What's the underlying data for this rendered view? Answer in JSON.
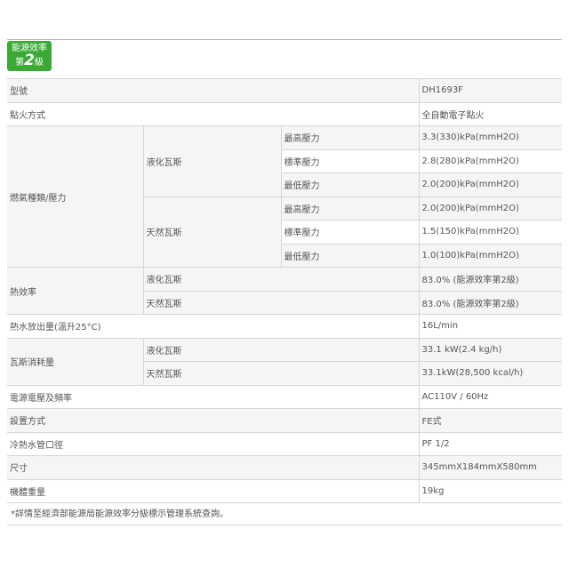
{
  "badge": {
    "line1": "能源效率",
    "rank_prefix": "第",
    "rank_num": "2",
    "rank_suffix": "級",
    "color": "#3aaa35"
  },
  "rows": {
    "model": {
      "label": "型號",
      "value": "DH1693F"
    },
    "ignition": {
      "label": "點火方式",
      "value": "全自動電子點火"
    },
    "gas_pressure": {
      "label": "燃氣種類/壓力",
      "lpg": {
        "label": "液化瓦斯",
        "max": {
          "label": "最高壓力",
          "value": "3.3(330)kPa(mmH2O)"
        },
        "std": {
          "label": "標準壓力",
          "value": "2.8(280)kPa(mmH2O)"
        },
        "min": {
          "label": "最低壓力",
          "value": "2.0(200)kPa(mmH2O)"
        }
      },
      "ng": {
        "label": "天然瓦斯",
        "max": {
          "label": "最高壓力",
          "value": "2.0(200)kPa(mmH2O)"
        },
        "std": {
          "label": "標準壓力",
          "value": "1.5(150)kPa(mmH2O)"
        },
        "min": {
          "label": "最低壓力",
          "value": "1.0(100)kPa(mmH2O)"
        }
      }
    },
    "efficiency": {
      "label": "熱效率",
      "lpg": {
        "label": "液化瓦斯",
        "value": "83.0% (能源效率第2級)"
      },
      "ng": {
        "label": "天然瓦斯",
        "value": "83.0% (能源效率第2級)"
      }
    },
    "hot_water": {
      "label": "熱水放出量(溫升25°C)",
      "value": "16L/min"
    },
    "consumption": {
      "label": "瓦斯消耗量",
      "lpg": {
        "label": "液化瓦斯",
        "value": "33.1 kW(2.4 kg/h)"
      },
      "ng": {
        "label": "天然瓦斯",
        "value": "33.1kW(28,500 kcal/h)"
      }
    },
    "power": {
      "label": "電源電壓及頻率",
      "value": "AC110V / 60Hz"
    },
    "install": {
      "label": "設置方式",
      "value": "FE式"
    },
    "pipe": {
      "label": "冷熱水管口徑",
      "value": "PF 1/2"
    },
    "size": {
      "label": "尺寸",
      "value": "345mmX184mmX580mm"
    },
    "weight": {
      "label": "機體重量",
      "value": "19kg"
    }
  },
  "note": "*詳情至經濟部能源局能源效率分級標示管理系統查詢。"
}
